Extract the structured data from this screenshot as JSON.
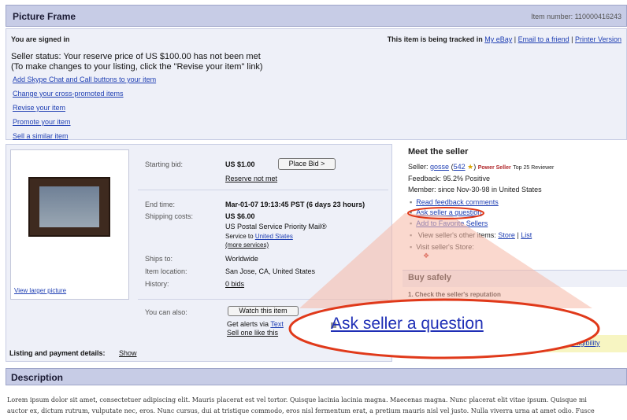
{
  "header": {
    "title": "Picture Frame",
    "item_number": "Item number: 110000416243"
  },
  "status_panel": {
    "signed_in": "You are signed in",
    "tracked_prefix": "This item is being tracked in",
    "my_ebay": "My eBay",
    "email_friend": "Email to a friend",
    "printer_version": "Printer Version",
    "seller_status": "Seller status: Your reserve price of US $100.00 has not been met",
    "seller_hint": "(To make changes to your listing, click the \"Revise your item\" link)",
    "links": [
      "Add Skype Chat and Call buttons to your item",
      "Change your cross-promoted items",
      "Revise your item",
      "Promote your item",
      "Sell a similar item"
    ]
  },
  "listing": {
    "view_larger": "View larger picture",
    "starting_bid_label": "Starting bid:",
    "starting_bid_value": "US $1.00",
    "reserve_not_met": "Reserve not met",
    "place_bid": "Place Bid >",
    "end_time_label": "End time:",
    "end_time_value": "Mar-01-07 19:13:45 PST (6 days 23 hours)",
    "shipping_label": "Shipping costs:",
    "shipping_value": "US $6.00",
    "shipping_service": "US Postal Service Priority Mail®",
    "service_to_prefix": "Service to",
    "service_to_link": "United States",
    "more_services": "(more services)",
    "ships_to_label": "Ships to:",
    "ships_to_value": "Worldwide",
    "location_label": "Item location:",
    "location_value": "San Jose, CA, United States",
    "history_label": "History:",
    "history_value": "0 bids",
    "also_label": "You can also:",
    "watch_button": "Watch this item",
    "alerts_prefix": "Get alerts via",
    "alerts_link": "Text",
    "sell_one": "Sell one like this",
    "payment_label": "Listing and payment details:",
    "payment_link": "Show"
  },
  "seller": {
    "title": "Meet the seller",
    "seller_label": "Seller:",
    "seller_name": "gosse",
    "feedback_count": "542",
    "power_seller": "Power Seller",
    "top_reviewer": "Top 25 Reviewer",
    "feedback_line": "Feedback: 95.2% Positive",
    "member_line": "Member:   since Nov-30-98 in United States",
    "links": [
      "Read feedback comments",
      "Ask seller a question",
      "Add to Favorite Sellers"
    ],
    "other_items_prefix": "View seller's other items:",
    "other_items_store": "Store",
    "other_items_list": "List",
    "store_label": "Visit seller's Store:",
    "buy_safely": "Buy safely",
    "check_reputation": "1.  Check the seller's reputation",
    "see_eligibility": "See eligibility"
  },
  "callout": {
    "text": "Ask seller a question",
    "color": "#e0391a"
  },
  "description": {
    "title": "Description",
    "line1": "Lorem ipsum dolor sit amet, consectetuer adipiscing elit. Mauris placerat est vel tortor. Quisque lacinia lacinia magna. Maecenas magna. Nunc placerat elit vitae ipsum. Quisque mi",
    "line2": "auctor ex, dictum rutrum, vulputate nec, eros. Nunc cursus, dui at tristique commodo, eros nisl fermentum erat, a pretium mauris nisl vel justo. Nulla viverra urna at amet odio. Fusce"
  }
}
